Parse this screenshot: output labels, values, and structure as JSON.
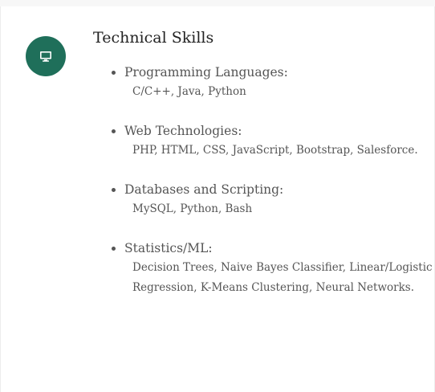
{
  "section": {
    "icon": "monitor-icon",
    "accent_color": "#1f6f5a",
    "title": "Technical Skills"
  },
  "skills": [
    {
      "category": "Programming Languages:",
      "items": "C/C++, Java, Python"
    },
    {
      "category": "Web Technologies:",
      "items": "PHP, HTML, CSS, JavaScript, Bootstrap, Salesforce."
    },
    {
      "category": "Databases and Scripting:",
      "items": "MySQL, Python, Bash"
    },
    {
      "category": "Statistics/ML:",
      "items": "Decision Trees, Naive Bayes Classifier, Linear/Logistic Regression, K-Means Clustering, Neural Networks."
    }
  ]
}
